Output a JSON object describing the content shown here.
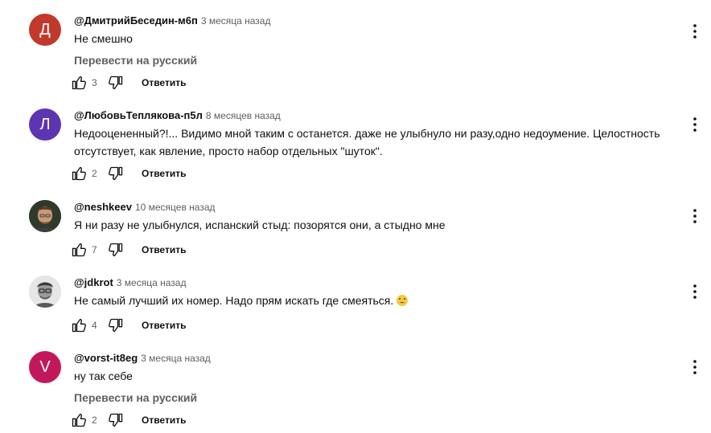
{
  "comments": [
    {
      "avatar_letter": "Д",
      "avatar_color": "#c0392b",
      "author": "@ДмитрийБеседин-м6п",
      "time": "3 месяца назад",
      "text": "Не смешно",
      "translate": "Перевести на русский",
      "likes": "3",
      "reply": "Ответить"
    },
    {
      "avatar_letter": "Л",
      "avatar_color": "#5e35b1",
      "author": "@ЛюбовьТеплякова-п5л",
      "time": "8 месяцев назад",
      "text": "Недооцененный?!... Видимо мной таким с останется. даже не улыбнуло ни разу,одно недоумение. Целостность отсутствует, как явление, просто набор отдельных \"шуток\".",
      "likes": "2",
      "reply": "Ответить"
    },
    {
      "avatar_type": "photo",
      "author": "@neshkeev",
      "time": "10 месяцев назад",
      "text": "Я ни разу не улыбнулся, испанский стыд: позорятся они, а стыдно мне",
      "likes": "7",
      "reply": "Ответить"
    },
    {
      "avatar_type": "photo",
      "author": "@jdkrot",
      "time": "3 месяца назад",
      "text": "Не самый лучший их номер. Надо прям искать где смеяться.",
      "emoji": "sad-face-emoji",
      "likes": "4",
      "reply": "Ответить"
    },
    {
      "avatar_letter": "V",
      "avatar_color": "#c2185b",
      "author": "@vorst-it8eg",
      "time": "3 месяца назад",
      "text": "ну так себе",
      "translate": "Перевести на русский",
      "likes": "2",
      "reply": "Ответить"
    }
  ],
  "icons": {
    "like": "thumb-up-icon",
    "dislike": "thumb-down-icon",
    "menu": "more-vert-icon"
  }
}
